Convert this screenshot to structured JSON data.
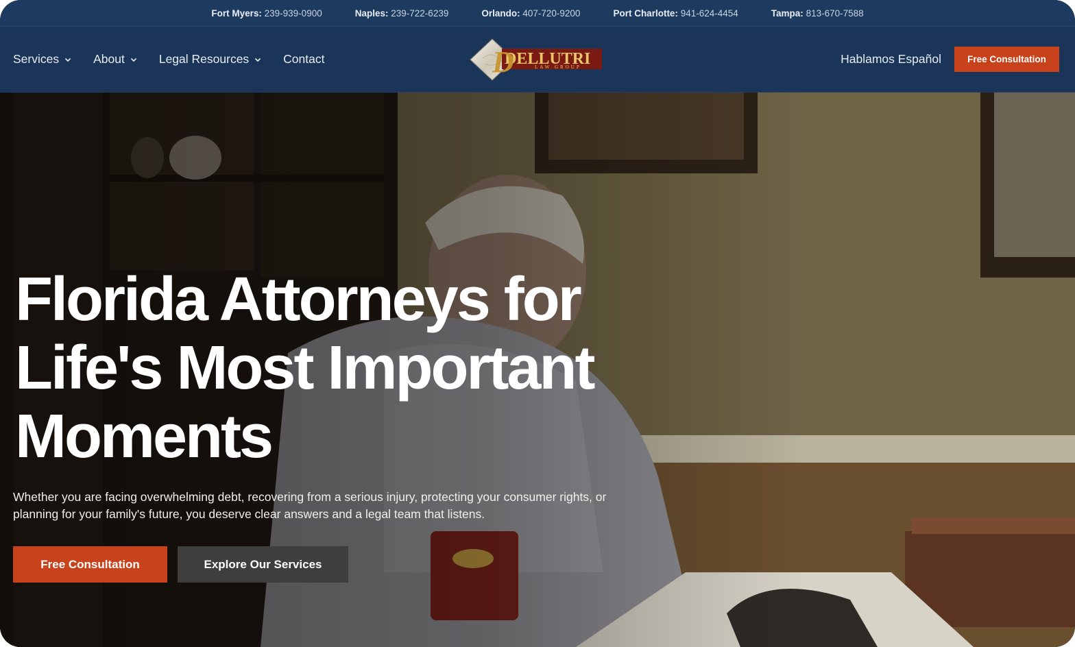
{
  "topbar": {
    "locations": [
      {
        "city": "Fort Myers:",
        "phone": "239-939-0900"
      },
      {
        "city": "Naples:",
        "phone": "239-722-6239"
      },
      {
        "city": "Orlando:",
        "phone": "407-720-9200"
      },
      {
        "city": "Port Charlotte:",
        "phone": "941-624-4454"
      },
      {
        "city": "Tampa:",
        "phone": "813-670-7588"
      }
    ]
  },
  "nav": {
    "items": [
      {
        "label": "Services",
        "has_dropdown": true
      },
      {
        "label": "About",
        "has_dropdown": true
      },
      {
        "label": "Legal Resources",
        "has_dropdown": true
      },
      {
        "label": "Contact",
        "has_dropdown": false
      }
    ],
    "logo": {
      "wordmark": "DELLUTRI",
      "subtext": "LAW GROUP"
    },
    "language_link": "Hablamos Español",
    "cta_label": "Free Consultation"
  },
  "hero": {
    "headline": "Florida Attorneys for Life's Most Important Moments",
    "subtext": "Whether you are facing overwhelming debt, recovering from a serious injury, protecting your consumer rights, or planning for your family's future, you deserve clear answers and a legal team that listens.",
    "primary_cta": "Free Consultation",
    "secondary_cta": "Explore Our Services"
  },
  "colors": {
    "navy": "#1b3558",
    "accent_orange": "#c8421c",
    "secondary_button": "#3f3e3f"
  }
}
